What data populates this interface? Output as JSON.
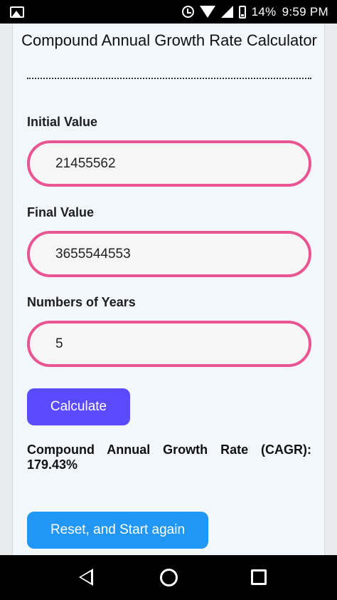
{
  "status_bar": {
    "battery_percent": "14%",
    "time": "9:59 PM"
  },
  "app": {
    "title": "Compound Annual Growth Rate Calculator",
    "fields": [
      {
        "label": "Initial Value",
        "value": "21455562"
      },
      {
        "label": "Final Value",
        "value": "3655544553"
      },
      {
        "label": "Numbers of Years",
        "value": "5"
      }
    ],
    "calculate_label": "Calculate",
    "result_label": "Compound Annual Growth Rate (CAGR):",
    "result_value": "179.43%",
    "reset_label": "Reset, and Start again"
  },
  "colors": {
    "field_border": "#e85592",
    "calculate_button": "#5b4bff",
    "reset_button": "#2196f3"
  },
  "icons": [
    "gallery-icon",
    "alarm-icon",
    "wifi-icon",
    "signal-icon",
    "battery-icon",
    "back-icon",
    "home-icon",
    "recents-icon"
  ]
}
